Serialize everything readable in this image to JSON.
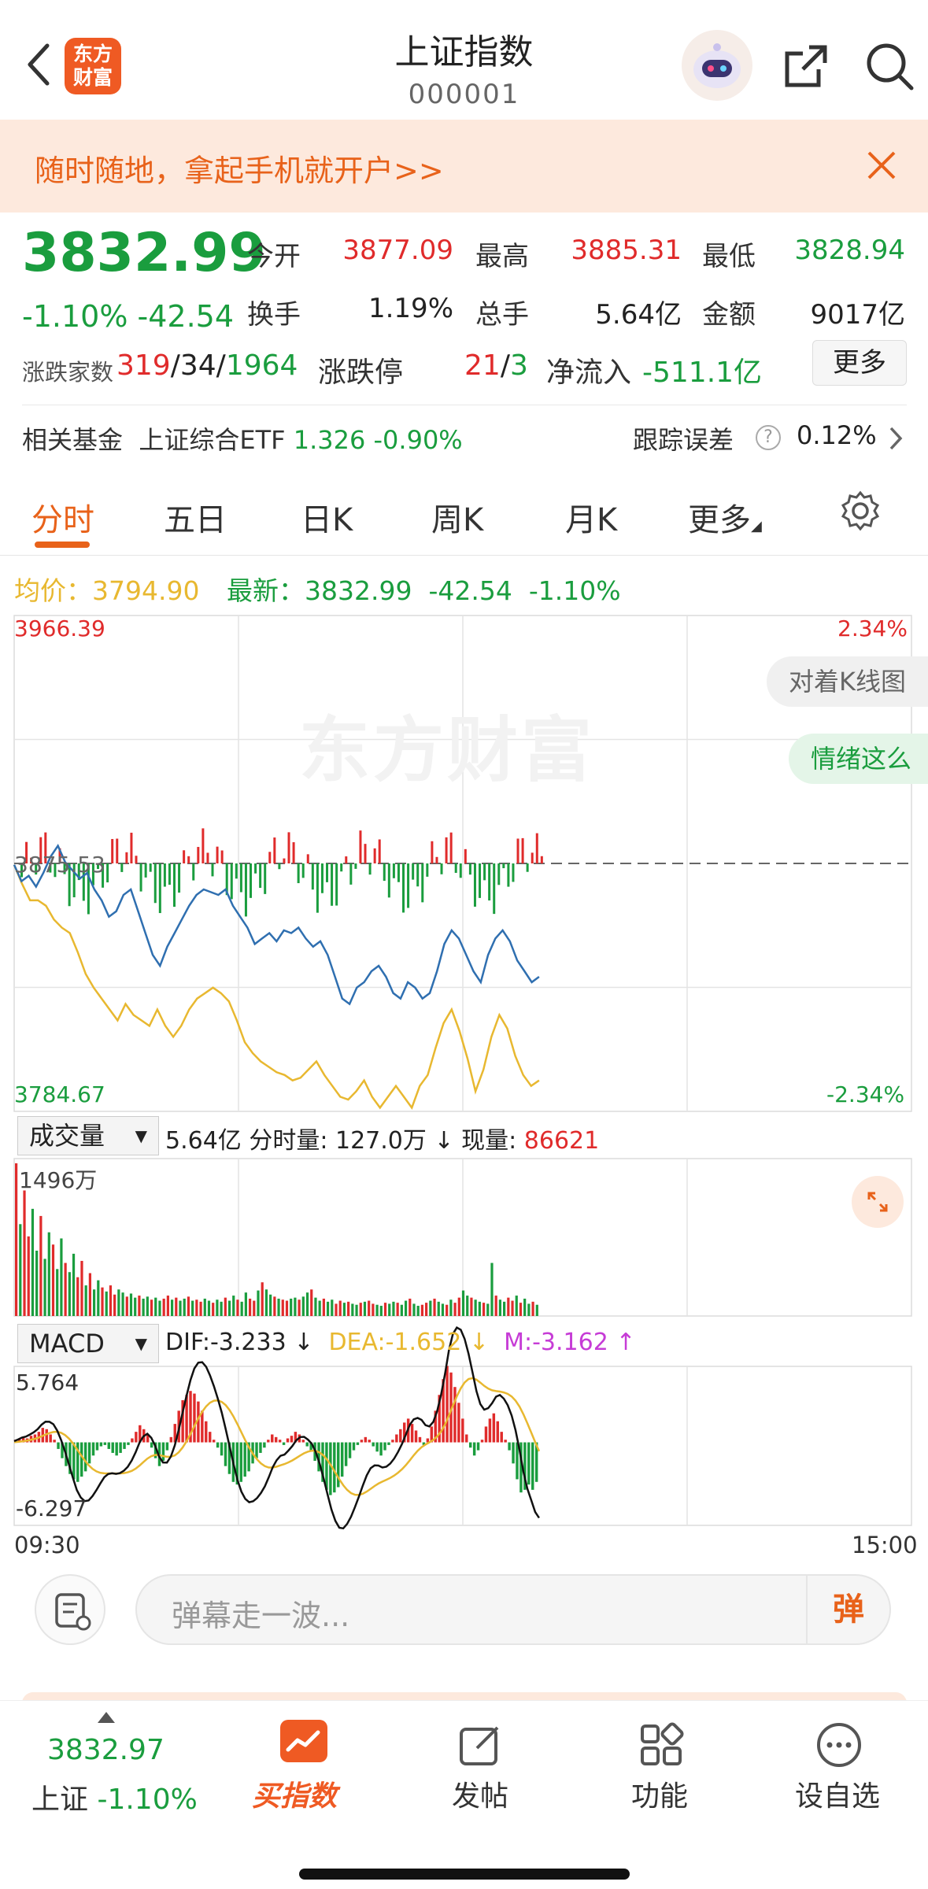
{
  "header": {
    "title": "上证指数",
    "code": "000001",
    "logo_text_1": "东方",
    "logo_text_2": "财富"
  },
  "banner": {
    "text": "随时随地，拿起手机就开户>>"
  },
  "quote": {
    "price": "3832.99",
    "change_pct": "-1.10%",
    "change": "-42.54",
    "open_label": "今开",
    "open": "3877.09",
    "high_label": "最高",
    "high": "3885.31",
    "low_label": "最低",
    "low": "3828.94",
    "turnover_label": "换手",
    "turnover": "1.19%",
    "volume_label": "总手",
    "volume": "5.64亿",
    "amount_label": "金额",
    "amount": "9017亿",
    "breadth_label": "涨跌家数",
    "up": "319",
    "flat": "34",
    "down": "1964",
    "limit_label": "涨跌停",
    "limit_up": "21",
    "limit_down": "3",
    "inflow_label": "净流入",
    "inflow": "-511.1亿",
    "more": "更多"
  },
  "fund": {
    "label": "相关基金",
    "name": "上证综合ETF",
    "price": "1.326",
    "pct": "-0.90%",
    "err_label": "跟踪误差",
    "err": "0.12%"
  },
  "tabs": [
    "分时",
    "五日",
    "日K",
    "周K",
    "月K",
    "更多"
  ],
  "legend": {
    "avg_label": "均价：",
    "avg": "3794.90",
    "last_label": "最新：",
    "last": "3832.99",
    "chg": "-42.54",
    "pct": "-1.10%"
  },
  "bubbles": [
    "对着K线图",
    "情绪这么"
  ],
  "watermark": "东方财富",
  "volume_bar": {
    "selector": "成交量",
    "total": "5.64亿",
    "tick_label": "分时量:",
    "tick": "127.0万",
    "now_label": "现量:",
    "now": "86621"
  },
  "macd_bar": {
    "selector": "MACD",
    "dif": "DIF:-3.233",
    "dea": "DEA:-1.652",
    "m": "M:-3.162"
  },
  "comment": {
    "placeholder": "弹幕走一波...",
    "send": "弹"
  },
  "tabbar": {
    "index_price": "3832.97",
    "index_name": "上证",
    "index_pct": "-1.10%",
    "buy": "买指数",
    "post": "发帖",
    "func": "功能",
    "watch": "设自选"
  },
  "colors": {
    "up": "#e02b2b",
    "down": "#1a9d3e",
    "accent": "#e8621a",
    "price_line": "#2f6fb0",
    "avg_line": "#e8b830"
  },
  "chart_data": [
    {
      "type": "line",
      "title": "",
      "x_labels": [
        "09:30",
        "15:00"
      ],
      "y_left_max": "3966.39",
      "y_left_min": "3784.67",
      "y_left_prev": "3875.53",
      "y_right_max": "2.34%",
      "y_right_min": "-2.34%",
      "ylim": [
        3784.67,
        3966.39
      ],
      "prev_close": 3875.53,
      "series": [
        {
          "values": [
            3875,
            3869,
            3871,
            3867,
            3872,
            3878,
            3882,
            3876,
            3873,
            3870,
            3872,
            3866,
            3862,
            3856,
            3858,
            3864,
            3866,
            3858,
            3850,
            3842,
            3838,
            3845,
            3850,
            3855,
            3860,
            3864,
            3866,
            3865,
            3864,
            3866,
            3860,
            3856,
            3852,
            3846,
            3848,
            3850,
            3847,
            3851,
            3850,
            3852,
            3848,
            3845,
            3847,
            3842,
            3834,
            3826,
            3824,
            3830,
            3832,
            3836,
            3838,
            3834,
            3828,
            3826,
            3832,
            3830,
            3826,
            3828,
            3836,
            3846,
            3851,
            3848,
            3842,
            3836,
            3832,
            3842,
            3848,
            3851,
            3847,
            3840,
            3836,
            3832,
            3834
          ]
        },
        {
          "values": [
            3875,
            3868,
            3862,
            3862,
            3860,
            3855,
            3852,
            3850,
            3843,
            3835,
            3830,
            3826,
            3822,
            3818,
            3824,
            3820,
            3818,
            3816,
            3822,
            3816,
            3812,
            3816,
            3822,
            3826,
            3828,
            3830,
            3828,
            3825,
            3818,
            3810,
            3806,
            3803,
            3801,
            3799,
            3798,
            3796,
            3797,
            3800,
            3803,
            3798,
            3794,
            3790,
            3789,
            3792,
            3796,
            3790,
            3786,
            3790,
            3794,
            3790,
            3786,
            3794,
            3798,
            3808,
            3817,
            3822,
            3814,
            3804,
            3792,
            3800,
            3812,
            3820,
            3815,
            3805,
            3798,
            3794,
            3796
          ]
        }
      ]
    },
    {
      "type": "bar",
      "title": "",
      "ylabel_max": "1496万",
      "ylim": [
        0,
        1496
      ],
      "values": [
        1496,
        900,
        1230,
        780,
        1050,
        640,
        980,
        560,
        820,
        700,
        460,
        760,
        520,
        430,
        610,
        380,
        540,
        300,
        420,
        260,
        350,
        280,
        240,
        300,
        210,
        260,
        230,
        190,
        220,
        180,
        200,
        170,
        190,
        160,
        180,
        150,
        170,
        200,
        160,
        180,
        150,
        170,
        190,
        150,
        160,
        140,
        170,
        150,
        130,
        160,
        140,
        180,
        150,
        200,
        160,
        140,
        230,
        170,
        150,
        250,
        330,
        260,
        210,
        190,
        170,
        160,
        150,
        170,
        180,
        160,
        190,
        230,
        260,
        180,
        150,
        170,
        140,
        160,
        120,
        150,
        130,
        140,
        120,
        110,
        130,
        140,
        150,
        120,
        110,
        100,
        130,
        120,
        140,
        130,
        110,
        150,
        170,
        120,
        100,
        110,
        130,
        150,
        170,
        140,
        120,
        110,
        160,
        130,
        180,
        250,
        200,
        180,
        160,
        140,
        130,
        120,
        520,
        200,
        160,
        140,
        180,
        150,
        200,
        130,
        170,
        120,
        140,
        110
      ]
    },
    {
      "type": "bar",
      "title": "",
      "ylabel_max": "5.764",
      "ylabel_min": "-6.297",
      "ylim": [
        -6.297,
        5.764
      ],
      "values": [
        0.2,
        0.3,
        0.4,
        0.3,
        0.5,
        0.6,
        0.8,
        1.1,
        1.0,
        0.6,
        0.2,
        -0.5,
        -1.2,
        -1.8,
        -2.4,
        -2.8,
        -3.0,
        -2.6,
        -2.2,
        -1.6,
        -1.0,
        -0.6,
        -0.3,
        -0.2,
        -0.5,
        -0.8,
        -1.0,
        -0.8,
        -0.5,
        -0.2,
        0.3,
        0.8,
        1.3,
        1.0,
        0.6,
        -0.4,
        -1.2,
        -1.8,
        -1.4,
        -0.6,
        0.4,
        1.4,
        2.4,
        3.2,
        3.6,
        3.9,
        3.7,
        3.1,
        2.4,
        1.6,
        0.8,
        0.2,
        -0.4,
        -1.0,
        -1.8,
        -2.4,
        -3.0,
        -3.2,
        -3.0,
        -2.6,
        -2.2,
        -1.6,
        -1.2,
        -0.8,
        -0.4,
        0.2,
        0.6,
        0.4,
        0.2,
        -0.2,
        0.3,
        0.5,
        0.8,
        0.6,
        0.2,
        -0.3,
        -0.6,
        -1.4,
        -2.2,
        -3.0,
        -3.6,
        -4.0,
        -3.8,
        -3.4,
        -2.6,
        -1.8,
        -1.2,
        -0.6,
        -0.2,
        0.2,
        0.4,
        0.2,
        -0.3,
        -0.7,
        -1.0,
        -0.6,
        -0.2,
        0.2,
        0.6,
        1.0,
        1.5,
        1.8,
        1.4,
        0.9,
        0.4,
        -0.2,
        0.3,
        1.2,
        2.4,
        3.6,
        4.8,
        5.8,
        5.3,
        4.2,
        3.0,
        1.8,
        0.6,
        -0.4,
        -1.0,
        -0.6,
        0.2,
        1.2,
        1.8,
        2.2,
        1.6,
        0.8,
        0.2,
        -0.6,
        -1.6,
        -2.8,
        -3.8,
        -3.6,
        -3.2,
        -3.6,
        -3.0
      ]
    }
  ]
}
